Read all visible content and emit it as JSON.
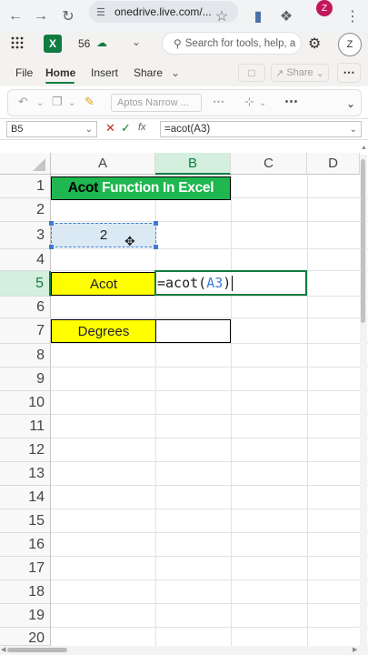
{
  "browser": {
    "url": "onedrive.live.com/...",
    "profile_initial": "Z",
    "icons": [
      "back-icon",
      "forward-icon",
      "reload-icon",
      "site-settings-icon",
      "bookmark-star-icon",
      "extension-icon",
      "puzzle-icon",
      "menu-dots-icon"
    ]
  },
  "excel_header": {
    "app_icon": "X",
    "autosave_count": "56",
    "search_placeholder": "Search for tools, help, a",
    "account_initial": "Z"
  },
  "ribbon": {
    "tabs": [
      "File",
      "Home",
      "Insert",
      "Share"
    ],
    "active_tab": "Home",
    "comment_label": "",
    "share_label": "Share",
    "font_name": "Aptos Narrow ..."
  },
  "formula_bar": {
    "name_box": "B5",
    "formula": "=acot(A3)"
  },
  "columns": [
    "A",
    "B",
    "C",
    "D"
  ],
  "rows": [
    "1",
    "2",
    "3",
    "4",
    "5",
    "6",
    "7",
    "8",
    "9",
    "10",
    "11",
    "12",
    "13",
    "14",
    "15",
    "16",
    "17",
    "18",
    "19",
    "20"
  ],
  "cells": {
    "A1_part1": "Acot",
    "A1_part2": "Function In Excel",
    "A3": "2",
    "A5": "Acot",
    "B5_prefix": "=acot(",
    "B5_ref": "A3",
    "B5_suffix": ")",
    "A7": "Degrees"
  },
  "colors": {
    "excel_green": "#107c41",
    "title_fill": "#1fb74f",
    "label_fill": "#ffff00",
    "selection_fill": "#dbe9f5"
  }
}
